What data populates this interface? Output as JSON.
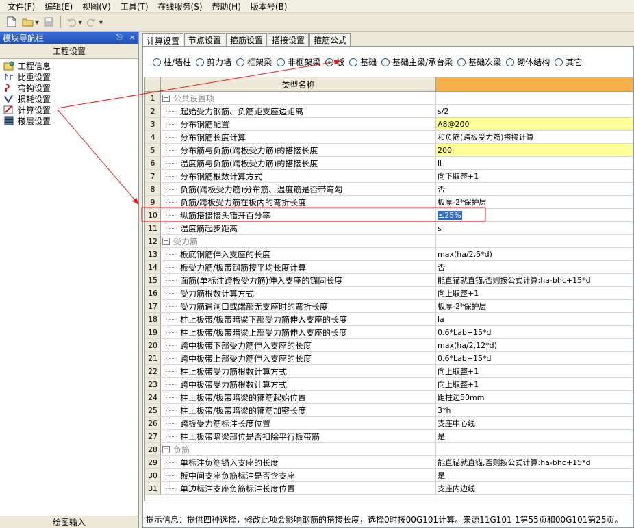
{
  "menu": [
    "文件(F)",
    "编辑(E)",
    "视图(V)",
    "工具(T)",
    "在线服务(S)",
    "帮助(H)",
    "版本号(B)"
  ],
  "toolbar": {
    "icons": [
      "new-file-icon",
      "open-folder-icon",
      "save-icon",
      "undo-icon",
      "redo-icon"
    ]
  },
  "nav": {
    "title": "模块导航栏",
    "pin": "ㅁ",
    "close": "×",
    "header": "工程设置",
    "items": [
      {
        "label": "工程信息",
        "icon": "project-info-icon"
      },
      {
        "label": "比重设置",
        "icon": "weight-icon"
      },
      {
        "label": "弯钩设置",
        "icon": "hook-icon"
      },
      {
        "label": "损耗设置",
        "icon": "loss-icon"
      },
      {
        "label": "计算设置",
        "icon": "calc-settings-icon"
      },
      {
        "label": "楼层设置",
        "icon": "floor-icon"
      }
    ],
    "footer": "绘图输入"
  },
  "tabs": [
    "计算设置",
    "节点设置",
    "箍筋设置",
    "搭接设置",
    "箍筋公式"
  ],
  "radios": [
    {
      "label": "柱/墙柱",
      "checked": false
    },
    {
      "label": "剪力墙",
      "checked": false
    },
    {
      "label": "框架梁",
      "checked": false
    },
    {
      "label": "非框架梁",
      "checked": false
    },
    {
      "label": "板",
      "checked": true
    },
    {
      "label": "基础",
      "checked": false
    },
    {
      "label": "基础主梁/承台梁",
      "checked": false
    },
    {
      "label": "基础次梁",
      "checked": false
    },
    {
      "label": "砌体结构",
      "checked": false
    },
    {
      "label": "其它",
      "checked": false
    }
  ],
  "grid": {
    "header": "类型名称",
    "rows": [
      {
        "n": "1",
        "name": "公共设置项",
        "value": "",
        "group": true
      },
      {
        "n": "2",
        "name": "起始受力钢筋、负筋距支座边距离",
        "value": "s/2"
      },
      {
        "n": "3",
        "name": "分布钢筋配置",
        "value": "A8@200",
        "yellow": true
      },
      {
        "n": "4",
        "name": "分布钢筋长度计算",
        "value": "和负筋(跨板受力筋)搭接计算"
      },
      {
        "n": "5",
        "name": "分布筋与负筋(跨板受力筋)的搭接长度",
        "value": "200",
        "yellow": true
      },
      {
        "n": "6",
        "name": "温度筋与负筋(跨板受力筋)的搭接长度",
        "value": "ll"
      },
      {
        "n": "7",
        "name": "分布钢筋根数计算方式",
        "value": "向下取整+1"
      },
      {
        "n": "8",
        "name": "负筋(跨板受力筋)分布筋、温度筋是否带弯勾",
        "value": "否"
      },
      {
        "n": "9",
        "name": "负筋/跨板受力筋在板内的弯折长度",
        "value": "板厚-2*保护层"
      },
      {
        "n": "10",
        "name": "纵筋搭接接头错开百分率",
        "value": "≤25%",
        "selected": true
      },
      {
        "n": "11",
        "name": "温度筋起步距离",
        "value": "s"
      },
      {
        "n": "12",
        "name": "受力筋",
        "value": "",
        "group": true
      },
      {
        "n": "13",
        "name": "板底钢筋伸入支座的长度",
        "value": "max(ha/2,5*d)"
      },
      {
        "n": "14",
        "name": "板受力筋/板带钢筋按平均长度计算",
        "value": "否"
      },
      {
        "n": "15",
        "name": "面筋(单标注跨板受力筋)伸入支座的锚固长度",
        "value": "能直锚就直锚,否则按公式计算:ha-bhc+15*d"
      },
      {
        "n": "16",
        "name": "受力筋根数计算方式",
        "value": "向上取整+1"
      },
      {
        "n": "17",
        "name": "受力筋遇洞口或端部无支座时的弯折长度",
        "value": "板厚-2*保护层"
      },
      {
        "n": "18",
        "name": "柱上板带/板带暗梁下部受力筋伸入支座的长度",
        "value": "la"
      },
      {
        "n": "19",
        "name": "柱上板带/板带暗梁上部受力筋伸入支座的长度",
        "value": "0.6*Lab+15*d"
      },
      {
        "n": "20",
        "name": "跨中板带下部受力筋伸入支座的长度",
        "value": "max(ha/2,12*d)"
      },
      {
        "n": "21",
        "name": "跨中板带上部受力筋伸入支座的长度",
        "value": "0.6*Lab+15*d"
      },
      {
        "n": "22",
        "name": "柱上板带受力筋根数计算方式",
        "value": "向上取整+1"
      },
      {
        "n": "23",
        "name": "跨中板带受力筋根数计算方式",
        "value": "向上取整+1"
      },
      {
        "n": "24",
        "name": "柱上板带/板带暗梁的箍筋起始位置",
        "value": "距柱边50mm"
      },
      {
        "n": "25",
        "name": "柱上板带/板带暗梁的箍筋加密长度",
        "value": "3*h"
      },
      {
        "n": "26",
        "name": "跨板受力筋标注长度位置",
        "value": "支座中心线"
      },
      {
        "n": "27",
        "name": "柱上板带暗梁部位是否扣除平行板带筋",
        "value": "是"
      },
      {
        "n": "28",
        "name": "负筋",
        "value": "",
        "group": true
      },
      {
        "n": "29",
        "name": "单标注负筋锚入支座的长度",
        "value": "能直锚就直锚,否则按公式计算:ha-bhc+15*d"
      },
      {
        "n": "30",
        "name": "板中间支座负筋标注是否含支座",
        "value": "是"
      },
      {
        "n": "31",
        "name": "单边标注支座负筋标注长度位置",
        "value": "支座内边线"
      }
    ]
  },
  "status": "提示信息：提供四种选择，修改此项会影响钢筋的搭接长度，选择0时按00G101计算。来源11G101-1第55页和00G101第25页。",
  "colors": {
    "annotation": "#e02020",
    "selection": "#316ac5",
    "highlight": "#ffff99",
    "header_accent": "#f5b04a"
  }
}
